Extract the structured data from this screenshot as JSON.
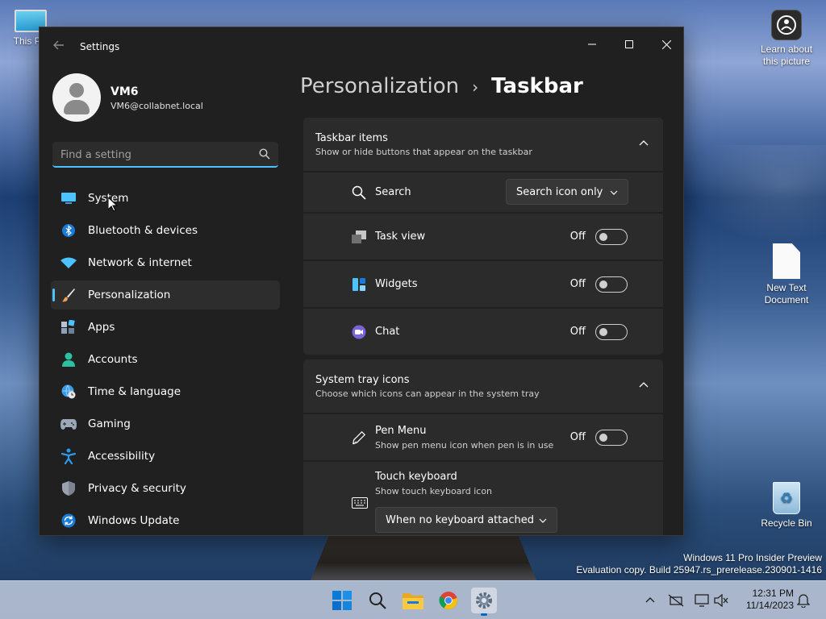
{
  "desktop": {
    "icons": [
      {
        "label": "This PC"
      },
      {
        "label": "Learn about this picture"
      },
      {
        "label": "New Text Document"
      },
      {
        "label": "Recycle Bin"
      }
    ],
    "watermark": {
      "line1": "Windows 11 Pro Insider Preview",
      "line2": "Evaluation copy. Build 25947.rs_prerelease.230901-1416"
    }
  },
  "window": {
    "title": "Settings",
    "controls": {
      "minimize": "—",
      "maximize": "☐",
      "close": "✕"
    }
  },
  "profile": {
    "name": "VM6",
    "email": "VM6@collabnet.local"
  },
  "search": {
    "placeholder": "Find a setting",
    "value": ""
  },
  "sidebar": {
    "active_index": 3,
    "items": [
      {
        "label": "System",
        "icon": "monitor-icon"
      },
      {
        "label": "Bluetooth & devices",
        "icon": "bluetooth-icon"
      },
      {
        "label": "Network & internet",
        "icon": "wifi-icon"
      },
      {
        "label": "Personalization",
        "icon": "brush-icon"
      },
      {
        "label": "Apps",
        "icon": "apps-icon"
      },
      {
        "label": "Accounts",
        "icon": "person-icon"
      },
      {
        "label": "Time & language",
        "icon": "globe-clock-icon"
      },
      {
        "label": "Gaming",
        "icon": "gamepad-icon"
      },
      {
        "label": "Accessibility",
        "icon": "accessibility-icon"
      },
      {
        "label": "Privacy & security",
        "icon": "shield-icon"
      },
      {
        "label": "Windows Update",
        "icon": "update-icon"
      }
    ]
  },
  "breadcrumb": {
    "parent": "Personalization",
    "separator": "›",
    "current": "Taskbar"
  },
  "taskbar_items": {
    "title": "Taskbar items",
    "subtitle": "Show or hide buttons that appear on the taskbar",
    "search": {
      "label": "Search",
      "value": "Search icon only"
    },
    "task_view": {
      "label": "Task view",
      "state": "Off"
    },
    "widgets": {
      "label": "Widgets",
      "state": "Off"
    },
    "chat": {
      "label": "Chat",
      "state": "Off"
    }
  },
  "system_tray": {
    "title": "System tray icons",
    "subtitle": "Choose which icons can appear in the system tray",
    "pen_menu": {
      "label": "Pen Menu",
      "subtitle": "Show pen menu icon when pen is in use",
      "state": "Off"
    },
    "touch_keyboard": {
      "label": "Touch keyboard",
      "subtitle": "Show touch keyboard icon",
      "value": "When no keyboard attached"
    }
  },
  "clock": {
    "time": "12:31 PM",
    "date": "11/14/2023"
  },
  "colors": {
    "accent": "#4cc2ff",
    "window_bg": "#202020",
    "card_bg": "#2b2b2b"
  }
}
